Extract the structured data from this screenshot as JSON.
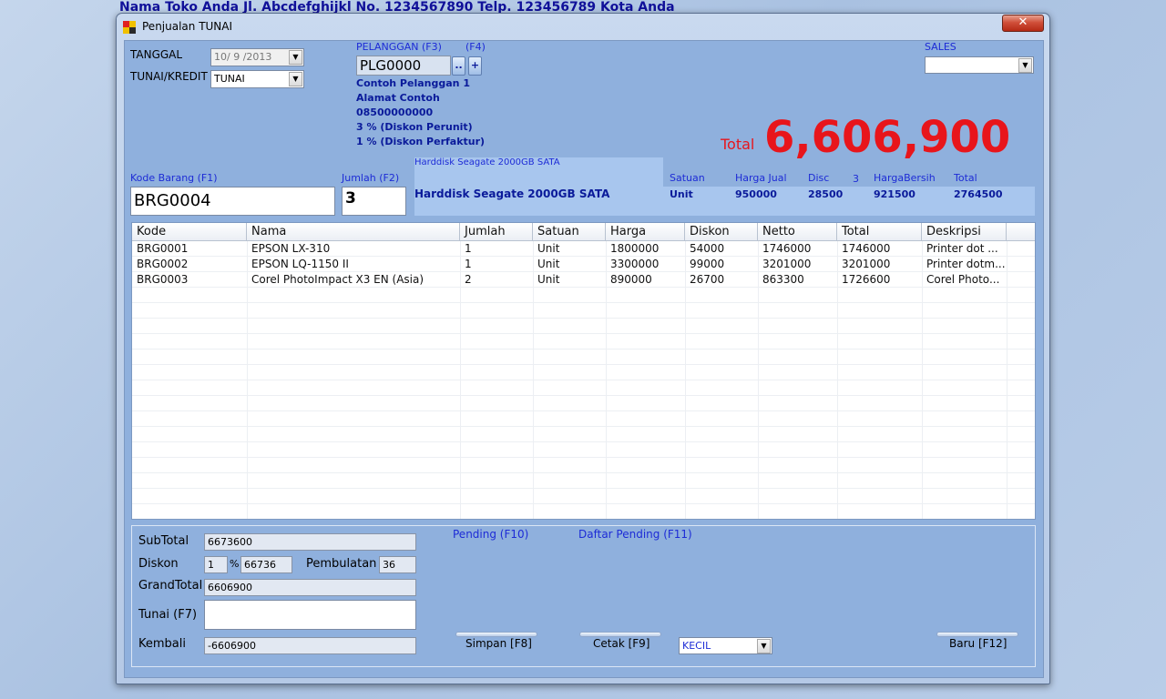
{
  "background_title": "Nama Toko Anda  Jl. Abcdefghijkl No. 1234567890  Telp. 123456789 Kota Anda",
  "window": {
    "title": "Penjualan TUNAI",
    "close_glyph": "✕"
  },
  "header": {
    "tanggal_label": "TANGGAL",
    "tanggal_value": "10/ 9 /2013",
    "tunai_kredit_label": "TUNAI/KREDIT",
    "tunai_kredit_value": "TUNAI",
    "pelanggan_label": "PELANGGAN (F3)",
    "f4_label": "(F4)",
    "pelanggan_code": "PLG0000",
    "browse_button": "..",
    "add_button": "+",
    "customer_name": "Contoh Pelanggan 1",
    "customer_address": "Alamat Contoh",
    "customer_phone": "08500000000",
    "diskon_perunit": "3 % (Diskon Perunit)",
    "diskon_perfaktur": "1 % (Diskon Perfaktur)",
    "sales_label": "SALES",
    "sales_value": "",
    "total_label": "Total",
    "total_value": "6,606,900"
  },
  "entry": {
    "kode_label": "Kode Barang (F1)",
    "kode_value": "BRG0004",
    "jumlah_label": "Jumlah (F2)",
    "jumlah_value": "3",
    "item_name_small": "Harddisk Seagate 2000GB SATA",
    "item_name": "Harddisk Seagate 2000GB SATA",
    "satuan_label": "Satuan",
    "satuan_value": "Unit",
    "harga_jual_label": "Harga Jual",
    "harga_jual_value": "950000",
    "disc_label": "Disc",
    "disc_pct": "3",
    "disc_value": "28500",
    "harga_bersih_label": "HargaBersih",
    "harga_bersih_value": "921500",
    "total_label": "Total",
    "total_value": "2764500"
  },
  "grid": {
    "columns": [
      "Kode",
      "Nama",
      "Jumlah",
      "Satuan",
      "Harga",
      "Diskon",
      "Netto",
      "Total",
      "Deskripsi"
    ],
    "rows": [
      [
        "BRG0001",
        "EPSON LX-310",
        "1",
        "Unit",
        "1800000",
        "54000",
        "1746000",
        "1746000",
        "Printer dot ..."
      ],
      [
        "BRG0002",
        "EPSON LQ-1150 II",
        "1",
        "Unit",
        "3300000",
        "99000",
        "3201000",
        "3201000",
        "Printer dotm..."
      ],
      [
        "BRG0003",
        "Corel PhotoImpact X3 EN (Asia)",
        "2",
        "Unit",
        "890000",
        "26700",
        "863300",
        "1726600",
        "Corel Photo..."
      ]
    ]
  },
  "footer": {
    "subtotal_label": "SubTotal",
    "subtotal_value": "6673600",
    "diskon_label": "Diskon",
    "diskon_pct": "1",
    "pct_symbol": "%",
    "diskon_value": "66736",
    "pembulatan_label": "Pembulatan",
    "pembulatan_value": "36",
    "grandtotal_label": "GrandTotal",
    "grandtotal_value": "6606900",
    "tunai_label": "Tunai (F7)",
    "tunai_value": "",
    "kembali_label": "Kembali",
    "kembali_value": "-6606900",
    "pending_link": "Pending (F10)",
    "daftar_pending_link": "Daftar Pending (F11)",
    "simpan_button": "Simpan [F8]",
    "cetak_button": "Cetak [F9]",
    "print_size_value": "KECIL",
    "baru_button": "Baru [F12]"
  },
  "colors": {
    "total_red": "#e8151b",
    "link_blue": "#1d2bd6",
    "label_darkblue": "#0a1a9a"
  }
}
